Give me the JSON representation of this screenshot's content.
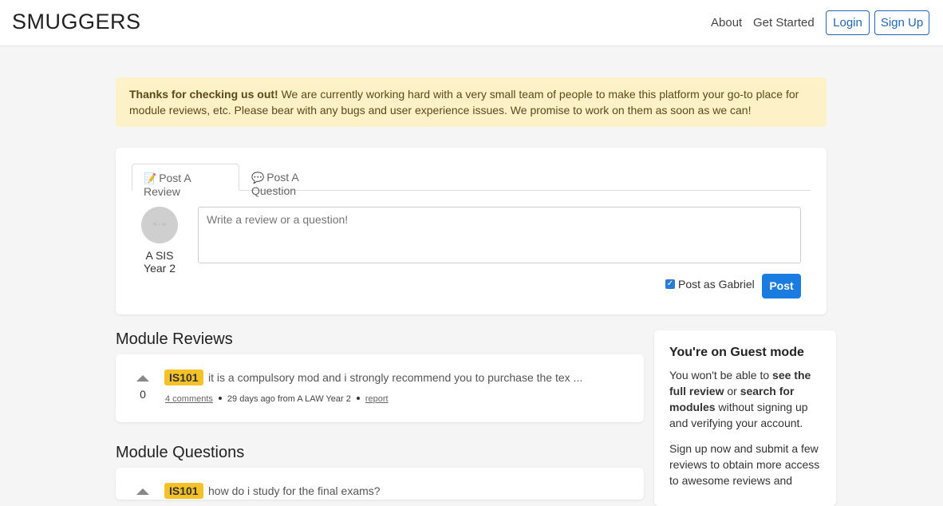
{
  "nav": {
    "brand": "SMUGGERS",
    "about": "About",
    "get_started": "Get Started",
    "login": "Login",
    "signup": "Sign Up"
  },
  "alert": {
    "bold": "Thanks for checking us out!",
    "text": " We are currently working hard with a very small team of people to make this platform your go-to place for module reviews, etc. Please bear with any bugs and user experience issues. We promise to work on them as soon as we can!"
  },
  "post": {
    "tabs": [
      {
        "emoji": "📝",
        "label": "Post A Review"
      },
      {
        "emoji": "💬",
        "label": "Post A Question"
      }
    ],
    "avatar_text": "46 × 46",
    "author_line1": "A SIS",
    "author_line2": "Year 2",
    "input_placeholder": "Write a review or a question!",
    "post_as_label": "Post as Gabriel",
    "post_as_checked": true,
    "post_button": "Post"
  },
  "reviews": {
    "title": "Module Reviews",
    "items": [
      {
        "votes": "0",
        "module": "IS101",
        "text": "it is a compulsory mod and i strongly recommend you to purchase the tex ...",
        "comments": "4 comments",
        "time_from": "29 days ago from A LAW Year 2",
        "report": "report"
      }
    ]
  },
  "questions": {
    "title": "Module Questions",
    "items": [
      {
        "module": "IS101",
        "text": "how do i study for the final exams?"
      }
    ]
  },
  "guest": {
    "title": "You're on Guest mode",
    "p1_a": "You won't be able to ",
    "p1_b": "see the full review",
    "p1_c": " or ",
    "p1_d": "search for modules",
    "p1_e": " without signing up and verifying your account.",
    "p2": "Sign up now and submit a few reviews to obtain more access to awesome reviews and"
  },
  "colors": {
    "primary": "#1a7be0",
    "badge": "#f4c127",
    "alert_bg": "#fdf2c7"
  }
}
